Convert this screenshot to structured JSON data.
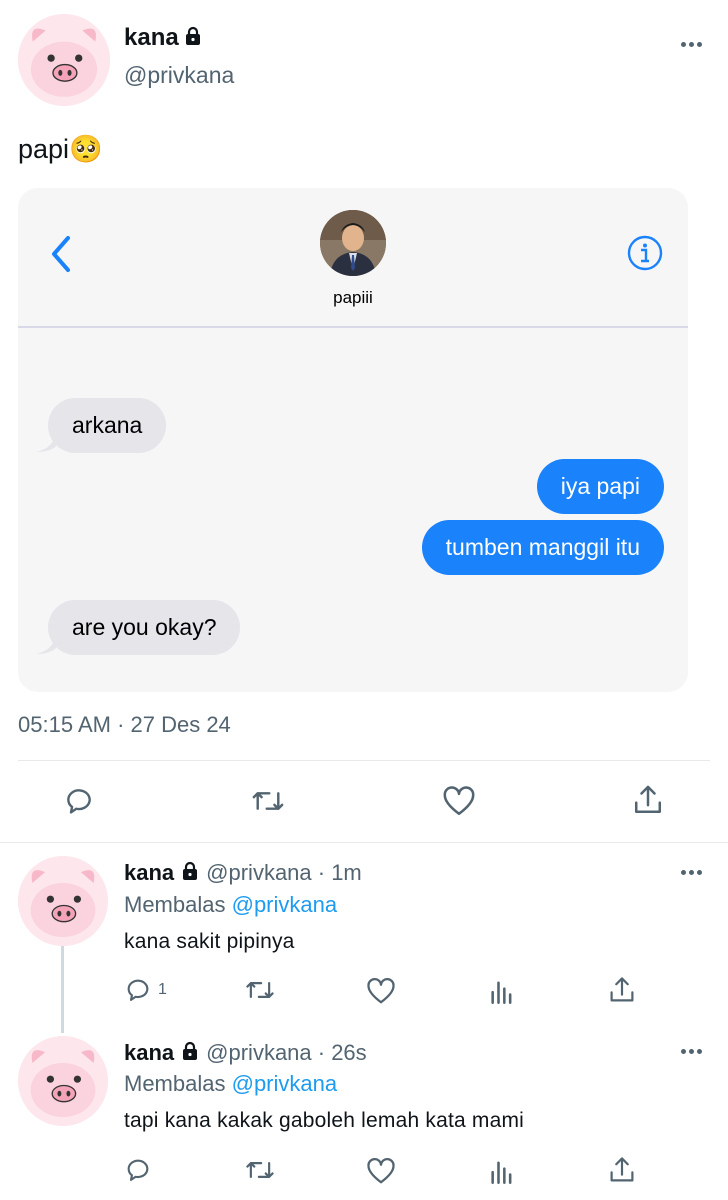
{
  "main_tweet": {
    "display_name": "kana",
    "handle": "@privkana",
    "text": "papi🥺",
    "timestamp": "05:15 AM · 27 Des 24",
    "embedded_chat": {
      "contact_name": "papiii",
      "messages": [
        {
          "direction": "in",
          "text": "arkana"
        },
        {
          "direction": "out",
          "text": "iya papi"
        },
        {
          "direction": "out",
          "text": "tumben manggil itu"
        },
        {
          "direction": "in",
          "text": "are you okay?"
        }
      ],
      "colors": {
        "outgoing": "#1a82fb",
        "incoming": "#e5e5ea",
        "accent": "#1a82fb"
      }
    }
  },
  "replies": [
    {
      "display_name": "kana",
      "meta": "@privkana · 1m",
      "replying_prefix": "Membalas",
      "replying_to": "@privkana",
      "text": "kana sakit pipinya",
      "reply_count": "1"
    },
    {
      "display_name": "kana",
      "meta": "@privkana · 26s",
      "replying_prefix": "Membalas",
      "replying_to": "@privkana",
      "text": "tapi kana kakak gaboleh lemah kata mami",
      "reply_count": ""
    }
  ],
  "icons": {
    "reply": "reply-icon",
    "retweet": "retweet-icon",
    "like": "heart-icon",
    "share": "share-icon",
    "views": "views-icon",
    "lock": "lock-icon",
    "more": "more-icon",
    "back": "chevron-left-icon",
    "info": "info-icon"
  },
  "colors": {
    "link": "#1d9bf0",
    "secondary_text": "#536471",
    "primary_text": "#0f1419"
  }
}
